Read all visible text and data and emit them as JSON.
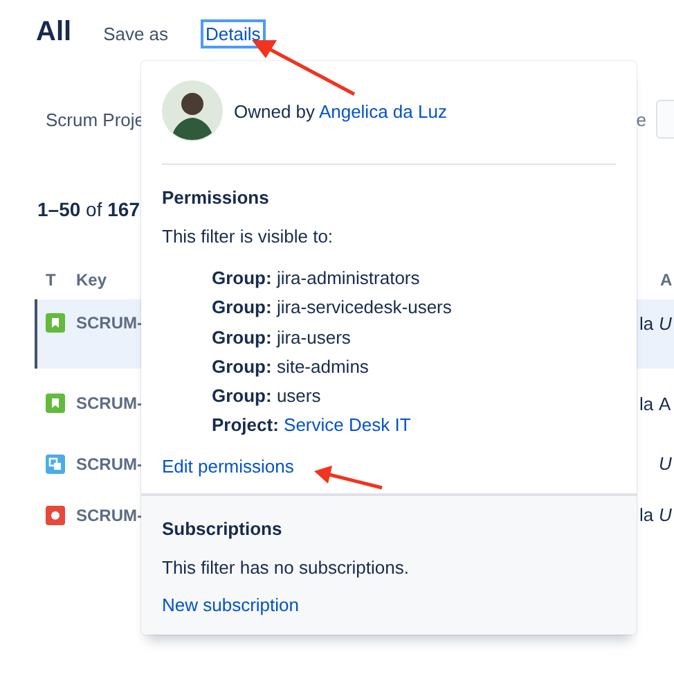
{
  "page": {
    "title": "All",
    "actions": [
      {
        "label": "Save as",
        "selected": false
      },
      {
        "label": "Details",
        "selected": true
      }
    ],
    "filter_bar": {
      "project_filter": "Scrum Proje",
      "right_label": "e"
    },
    "results": {
      "count": "**1–50** of **167**"
    },
    "table": {
      "columns": [
        "T",
        "Key",
        "A"
      ],
      "rows": [
        {
          "kind": "story",
          "key": "SCRUM-",
          "column_3": "la",
          "column_4": "U",
          "column_4_italic": true,
          "selected": true
        },
        {
          "kind": "story",
          "key": "SCRUM-",
          "column_3": "la",
          "column_4": "A",
          "column_4_italic": false,
          "selected": false
        },
        {
          "kind": "subtask",
          "key": "SCRUM-",
          "column_4": "U",
          "column_4_italic": true,
          "selected": false
        },
        {
          "kind": "bug",
          "key": "SCRUM-",
          "column_3": "la",
          "column_4": "U",
          "column_4_italic": true,
          "selected": false
        }
      ]
    }
  },
  "details_popup": {
    "owner_prefix": "Owned by",
    "owner": "Angelica da Luz",
    "permissions": {
      "heading": "Permissions",
      "intro": "This filter is visible to:",
      "entries": [
        {
          "type": "Group:",
          "name": "jira-administrators",
          "link": false
        },
        {
          "type": "Group:",
          "name": "jira-servicedesk-users",
          "link": false
        },
        {
          "type": "Group:",
          "name": "jira-users",
          "link": false
        },
        {
          "type": "Group:",
          "name": "site-admins",
          "link": false
        },
        {
          "type": "Group:",
          "name": "users",
          "link": false
        },
        {
          "type": "Project:",
          "name": "Service Desk IT",
          "link": true
        }
      ],
      "edit_link": "Edit permissions"
    },
    "subscriptions": {
      "heading": "Subscriptions",
      "text": "This filter has no subscriptions.",
      "new_link": "New subscription"
    }
  }
}
